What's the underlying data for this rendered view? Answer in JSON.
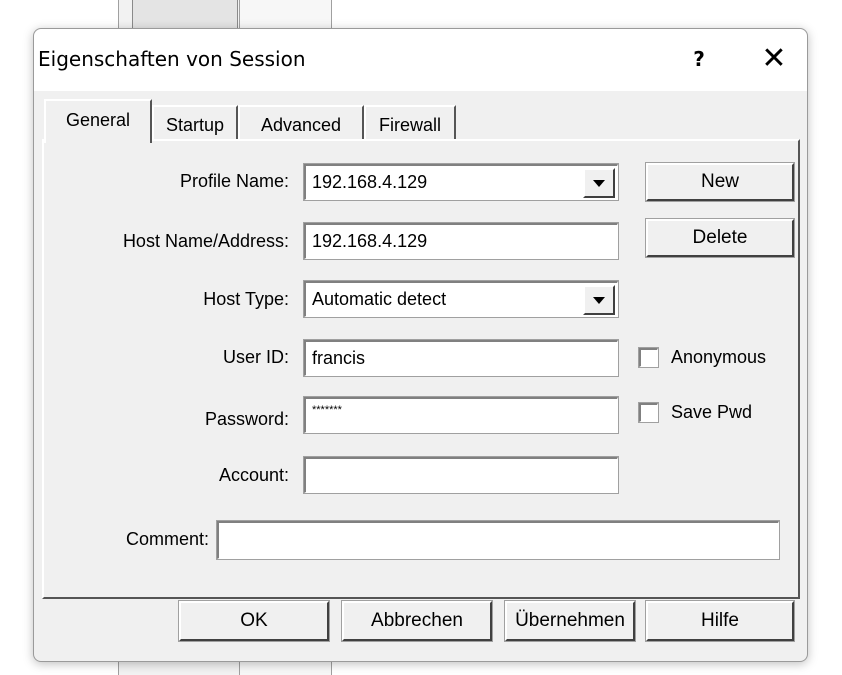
{
  "window": {
    "title": "Eigenschaften von Session",
    "help_glyph": "?",
    "close_glyph": "✕"
  },
  "tabs": [
    {
      "label": "General",
      "active": true
    },
    {
      "label": "Startup",
      "active": false
    },
    {
      "label": "Advanced",
      "active": false
    },
    {
      "label": "Firewall",
      "active": false
    }
  ],
  "form": {
    "profile_name": {
      "label": "Profile Name:",
      "value": "192.168.4.129"
    },
    "host_name": {
      "label": "Host Name/Address:",
      "value": "192.168.4.129"
    },
    "host_type": {
      "label": "Host Type:",
      "value": "Automatic detect"
    },
    "user_id": {
      "label": "User ID:",
      "value": "francis"
    },
    "password": {
      "label": "Password:",
      "value": "*******"
    },
    "account": {
      "label": "Account:",
      "value": ""
    },
    "comment": {
      "label": "Comment:",
      "value": ""
    }
  },
  "side_buttons": {
    "new": "New",
    "delete": "Delete"
  },
  "checkboxes": {
    "anonymous": {
      "label": "Anonymous",
      "checked": false
    },
    "save_pwd": {
      "label": "Save Pwd",
      "checked": false
    }
  },
  "footer": {
    "ok": "OK",
    "cancel": "Abbrechen",
    "apply": "Übernehmen",
    "help": "Hilfe"
  }
}
